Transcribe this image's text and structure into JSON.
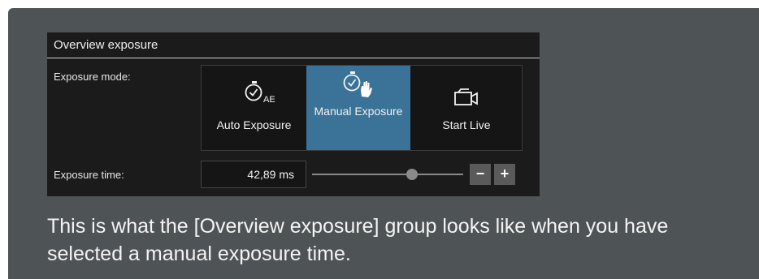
{
  "panel": {
    "title": "Overview exposure",
    "exposure_mode_label": "Exposure mode:",
    "exposure_time_label": "Exposure time:",
    "modes": [
      {
        "label": "Auto Exposure",
        "icon": "stopwatch-icon",
        "sub": "AE",
        "selected": false
      },
      {
        "label": "Manual Exposure",
        "icon": "stopwatch-hand-icon",
        "selected": true
      },
      {
        "label": "Start Live",
        "icon": "video-camera-icon",
        "selected": false
      }
    ],
    "exposure_time_value": "42,89 ms",
    "slider_level": 0.66,
    "minus_label": "−",
    "plus_label": "+"
  },
  "caption": "This is what the [Overview exposure] group looks like when you have selected a manual exposure time.",
  "colors": {
    "background": "#4e5355",
    "panel": "#1b1b1b",
    "selected": "#3a7298"
  }
}
